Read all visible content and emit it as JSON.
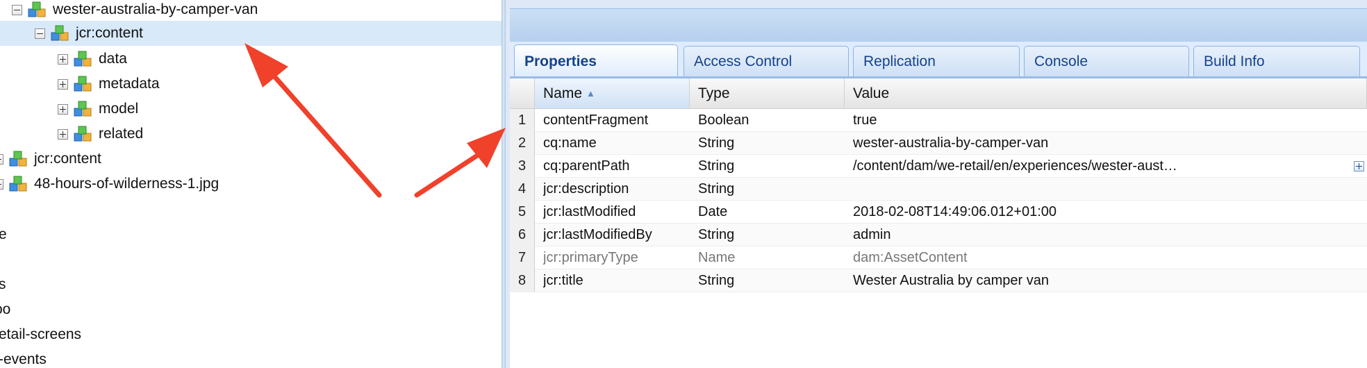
{
  "tree": {
    "nodes": [
      {
        "label": "wester-australia-by-camper-van",
        "toggle": "minus"
      },
      {
        "label": "jcr:content",
        "toggle": "minus",
        "selected": true
      },
      {
        "label": "data",
        "toggle": "plus"
      },
      {
        "label": "metadata",
        "toggle": "plus"
      },
      {
        "label": "model",
        "toggle": "plus"
      },
      {
        "label": "related",
        "toggle": "plus"
      },
      {
        "label": "jcr:content",
        "toggle": "plus"
      },
      {
        "label": "48-hours-of-wilderness-1.jpg",
        "toggle": "plus"
      }
    ],
    "partial_labels": [
      "e",
      "s",
      "oo",
      "etail-screens",
      "-events"
    ]
  },
  "tabs": [
    "Properties",
    "Access Control",
    "Replication",
    "Console",
    "Build Info"
  ],
  "active_tab": "Properties",
  "grid": {
    "columns": [
      "Name",
      "Type",
      "Value"
    ],
    "sort_column": "Name",
    "rows": [
      {
        "num": "1",
        "name": "contentFragment",
        "type": "Boolean",
        "value": "true"
      },
      {
        "num": "2",
        "name": "cq:name",
        "type": "String",
        "value": "wester-australia-by-camper-van"
      },
      {
        "num": "3",
        "name": "cq:parentPath",
        "type": "String",
        "value": "/content/dam/we-retail/en/experiences/wester-australia-by-camper-van"
      },
      {
        "num": "4",
        "name": "jcr:description",
        "type": "String",
        "value": ""
      },
      {
        "num": "5",
        "name": "jcr:lastModified",
        "type": "Date",
        "value": "2018-02-08T14:49:06.012+01:00"
      },
      {
        "num": "6",
        "name": "jcr:lastModifiedBy",
        "type": "String",
        "value": "admin"
      },
      {
        "num": "7",
        "name": "jcr:primaryType",
        "type": "Name",
        "value": "dam:AssetContent"
      },
      {
        "num": "8",
        "name": "jcr:title",
        "type": "String",
        "value": "Wester Australia by camper van"
      }
    ]
  },
  "colors": {
    "accent": "#15428b",
    "selection": "#d8e9f9",
    "arrow": "#f0412b"
  },
  "icons": {
    "node": "jcr-node-icon",
    "sort": "sort-asc-icon",
    "expand": "expand-value-icon"
  }
}
